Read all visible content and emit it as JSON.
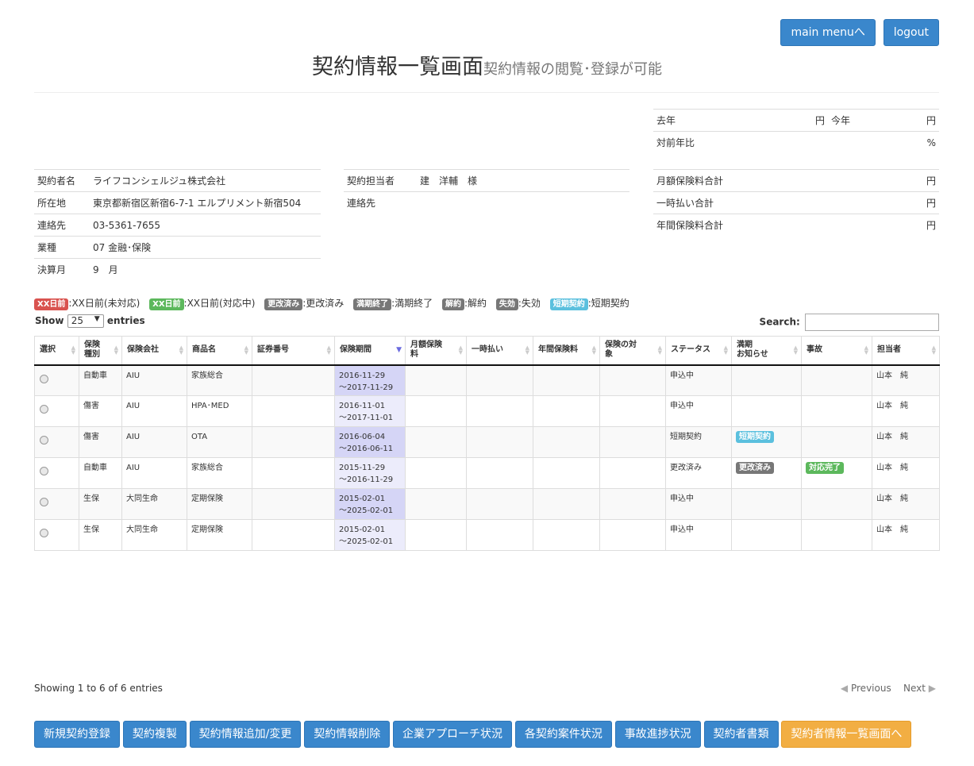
{
  "header": {
    "main_menu_label": "main menuへ",
    "logout_label": "logout",
    "title": "契約情報一覧画面",
    "subtitle": "契約情報の閲覧･登録が可能"
  },
  "summary": {
    "last_year_label": "去年",
    "last_year_unit": "円",
    "this_year_label": "今年",
    "this_year_unit": "円",
    "yoy_label": "対前年比",
    "yoy_unit": "%",
    "monthly_total_label": "月額保険料合計",
    "monthly_total_unit": "円",
    "lump_total_label": "一時払い合計",
    "lump_total_unit": "円",
    "annual_total_label": "年間保険料合計",
    "annual_total_unit": "円"
  },
  "contractor": {
    "name_label": "契約者名",
    "name_value": "ライフコンシェルジュ株式会社",
    "address_label": "所在地",
    "address_value": "東京都新宿区新宿6-7-1 エルプリメント新宿504",
    "contact_label": "連絡先",
    "contact_value": "03-5361-7655",
    "industry_label": "業種",
    "industry_value": "07 金融･保険",
    "fiscal_label": "決算月",
    "fiscal_value": "9　月"
  },
  "person": {
    "person_label": "契約担当者",
    "person_value": "建　洋輔　様",
    "contact_label": "連絡先",
    "contact_value": ""
  },
  "legend": [
    {
      "badge": "XX日前",
      "text": ":XX日前(未対応)",
      "color": "red"
    },
    {
      "badge": "XX日前",
      "text": ":XX日前(対応中)",
      "color": "green"
    },
    {
      "badge": "更改済み",
      "text": ":更改済み",
      "color": "gray"
    },
    {
      "badge": "満期終了",
      "text": ":満期終了",
      "color": "gray"
    },
    {
      "badge": "解約",
      "text": ":解約",
      "color": "gray"
    },
    {
      "badge": "失効",
      "text": ":失効",
      "color": "gray"
    },
    {
      "badge": "短期契約",
      "text": ":短期契約",
      "color": "info"
    }
  ],
  "table_controls": {
    "show_label": "Show",
    "entries_value": "25",
    "entries_label": "entries",
    "search_label": "Search:",
    "search_value": ""
  },
  "columns": [
    "選択",
    "保険\n種別",
    "保険会社",
    "商品名",
    "証券番号",
    "保険期間",
    "月額保険\n料",
    "一時払い",
    "年間保険料",
    "保険の対\n象",
    "ステータス",
    "満期\nお知らせ",
    "事故",
    "担当者"
  ],
  "rows": [
    {
      "type": "自動車",
      "company": "AIU",
      "product": "家族総合",
      "policy": "",
      "period_start": "2016-11-29",
      "period_end": "～2017-11-29",
      "monthly": "",
      "lump": "",
      "annual": "",
      "target": "",
      "status": "申込中",
      "notice": "",
      "accident": "",
      "staff": "山本　純"
    },
    {
      "type": "傷害",
      "company": "AIU",
      "product": "HPA･MED",
      "policy": "",
      "period_start": "2016-11-01",
      "period_end": "～2017-11-01",
      "monthly": "",
      "lump": "",
      "annual": "",
      "target": "",
      "status": "申込中",
      "notice": "",
      "accident": "",
      "staff": "山本　純"
    },
    {
      "type": "傷害",
      "company": "AIU",
      "product": "OTA",
      "policy": "",
      "period_start": "2016-06-04",
      "period_end": "～2016-06-11",
      "monthly": "",
      "lump": "",
      "annual": "",
      "target": "",
      "status": "短期契約",
      "notice": "短期契約",
      "notice_color": "info",
      "accident": "",
      "staff": "山本　純"
    },
    {
      "type": "自動車",
      "company": "AIU",
      "product": "家族総合",
      "policy": "",
      "period_start": "2015-11-29",
      "period_end": "～2016-11-29",
      "monthly": "",
      "lump": "",
      "annual": "",
      "target": "",
      "status": "更改済み",
      "notice": "更改済み",
      "notice_color": "gray",
      "accident": "対応完了",
      "accident_color": "green",
      "staff": "山本　純"
    },
    {
      "type": "生保",
      "company": "大同生命",
      "product": "定期保険",
      "policy": "",
      "period_start": "2015-02-01",
      "period_end": "～2025-02-01",
      "monthly": "",
      "lump": "",
      "annual": "",
      "target": "",
      "status": "申込中",
      "notice": "",
      "accident": "",
      "staff": "山本　純"
    },
    {
      "type": "生保",
      "company": "大同生命",
      "product": "定期保険",
      "policy": "",
      "period_start": "2015-02-01",
      "period_end": "～2025-02-01",
      "monthly": "",
      "lump": "",
      "annual": "",
      "target": "",
      "status": "申込中",
      "notice": "",
      "accident": "",
      "staff": "山本　純"
    }
  ],
  "footer": {
    "info": "Showing 1 to 6 of 6 entries",
    "previous": "Previous",
    "next": "Next"
  },
  "bottom_buttons": [
    {
      "label": "新規契約登録",
      "color": "blue"
    },
    {
      "label": "契約複製",
      "color": "blue"
    },
    {
      "label": "契約情報追加/変更",
      "color": "blue"
    },
    {
      "label": "契約情報削除",
      "color": "blue"
    },
    {
      "label": "企業アプローチ状況",
      "color": "blue"
    },
    {
      "label": "各契約案件状況",
      "color": "blue"
    },
    {
      "label": "事故進捗状況",
      "color": "blue"
    },
    {
      "label": "契約者書類",
      "color": "blue"
    },
    {
      "label": "契約者情報一覧画面へ",
      "color": "orange"
    }
  ]
}
